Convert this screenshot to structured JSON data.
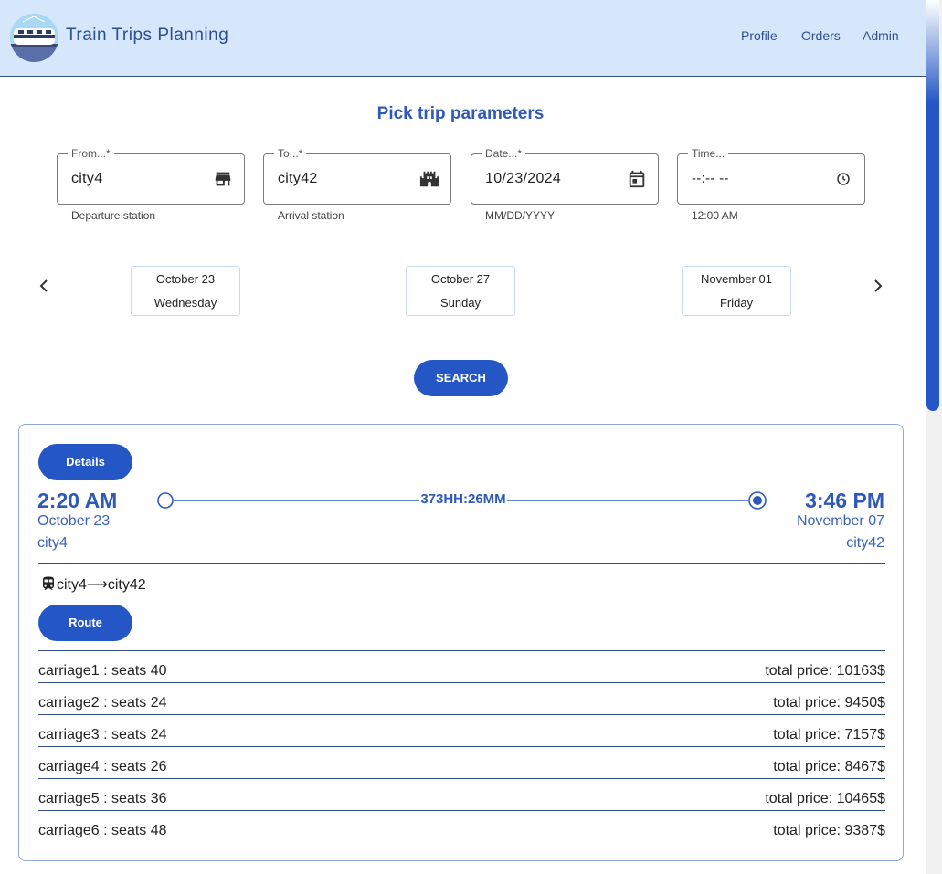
{
  "header": {
    "title": "Train Trips Planning",
    "nav": [
      {
        "label": "Profile"
      },
      {
        "label": "Orders"
      },
      {
        "label": "Admin"
      }
    ]
  },
  "form": {
    "title": "Pick trip parameters",
    "fields": [
      {
        "label": "From...*",
        "value": "city4",
        "hint": "Departure station",
        "icon": "store-icon"
      },
      {
        "label": "To...*",
        "value": "city42",
        "hint": "Arrival station",
        "icon": "castle-icon"
      },
      {
        "label": "Date...*",
        "value": "10/23/2024",
        "hint": "MM/DD/YYYY",
        "icon": "calendar-icon"
      },
      {
        "label": "Time...",
        "value": "--:-- --",
        "hint": "12:00 AM",
        "icon": "clock-icon"
      }
    ],
    "dates": [
      {
        "date": "October 23",
        "weekday": "Wednesday"
      },
      {
        "date": "October 27",
        "weekday": "Sunday"
      },
      {
        "date": "November 01",
        "weekday": "Friday"
      }
    ],
    "search_label": "SEARCH"
  },
  "trip": {
    "details_label": "Details",
    "depart_time": "2:20 AM",
    "depart_date": "October 23",
    "depart_city": "city4",
    "arrive_time": "3:46 PM",
    "arrive_date": "November 07",
    "arrive_city": "city42",
    "duration": "373HH:26MM",
    "route_from": "city4",
    "route_to": "city42",
    "route_label": "Route",
    "carriages": [
      {
        "name": "carriage1 : seats 40",
        "price": "total price: 10163$"
      },
      {
        "name": "carriage2 : seats 24",
        "price": "total price: 9450$"
      },
      {
        "name": "carriage3 : seats 24",
        "price": "total price: 7157$"
      },
      {
        "name": "carriage4 : seats 26",
        "price": "total price: 8467$"
      },
      {
        "name": "carriage5 : seats 36",
        "price": "total price: 10465$"
      },
      {
        "name": "carriage6 : seats 48",
        "price": "total price: 9387$"
      }
    ]
  },
  "colors": {
    "accent": "#2457c5",
    "header_bg": "#d6e6fb",
    "text_blue": "#2f59b8"
  }
}
